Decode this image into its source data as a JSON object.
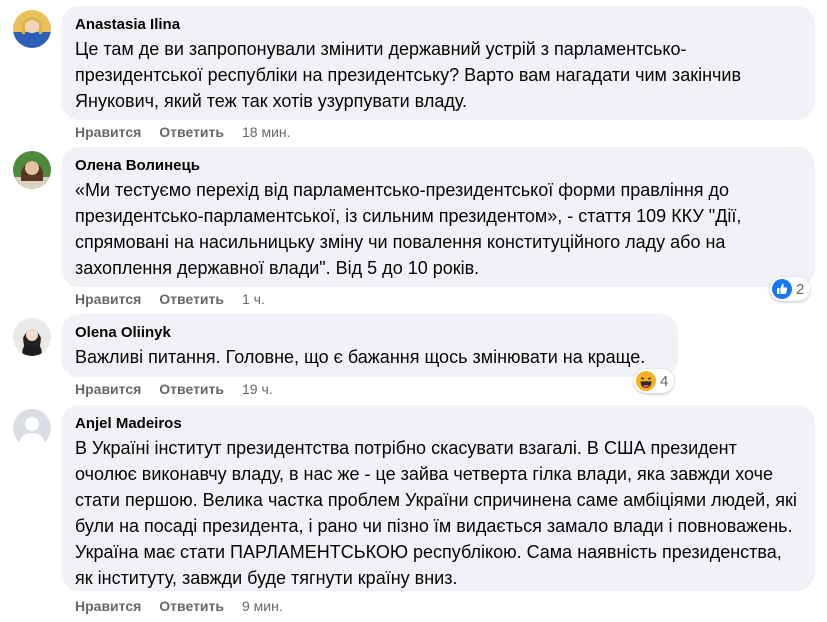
{
  "actions": {
    "like": "Нравится",
    "reply": "Ответить"
  },
  "comments": [
    {
      "author": "Anastasia Ilina",
      "text": "Це там де ви запропонували змінити державний устрій з парламентсько-президентської республіки на президентську? Варто вам нагадати чим закінчив Янукович, який теж так хотів узурпувати владу.",
      "time": "18 мин.",
      "reaction_count": ""
    },
    {
      "author": "Олена Волинець",
      "text": "«Ми тестуємо перехід від парламентсько-президентської форми правління до президентсько-парламентської, із сильним президентом», - стаття 109 ККУ \"Дії, спрямовані на насильницьку зміну чи повалення конституційного ладу або на захоплення державної влади\". Від 5 до 10 років.",
      "time": "1 ч.",
      "reaction_count": "2",
      "reaction_icon": "like-icon"
    },
    {
      "author": "Olena Oliinyk",
      "text": "Важливі питання. Головне, що є бажання щось змінювати на краще.",
      "time": "19 ч.",
      "reaction_count": "4",
      "reaction_icon": "haha-icon"
    },
    {
      "author": "Anjel Madeiros",
      "text": "В Україні інститут президентства потрібно скасувати взагалі. В США президент очолює виконавчу владу, в нас же - це зайва четверта гілка влади, яка завжди хоче стати першою. Велика частка проблем України спричинена саме амбіціями людей, які були на посаді президента, і рано чи пізно їм видається замало влади і повноважень. Україна має стати ПАРЛАМЕНТСЬКОЮ республікою. Сама наявність президенства, як інституту, завжди буде тягнути країну вниз.",
      "time": "9 мин.",
      "reaction_count": ""
    }
  ],
  "colors": {
    "bubble": "#f0f2f5",
    "meta": "#65676b",
    "like_blue": "#1877f2",
    "haha_yellow": "#f7b125"
  }
}
